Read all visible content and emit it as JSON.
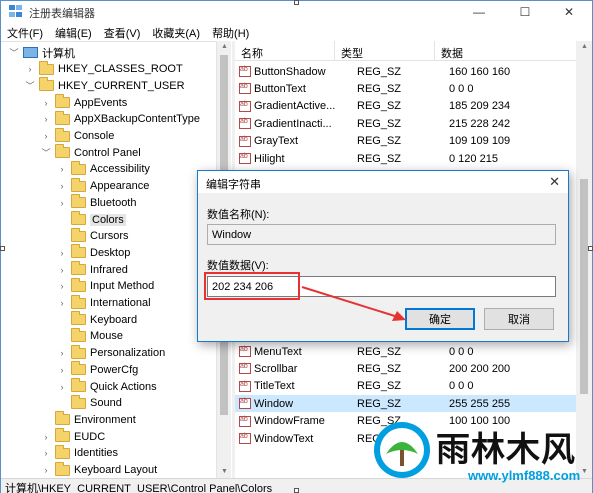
{
  "window": {
    "title": "注册表编辑器",
    "minimize": "—",
    "maximize": "☐",
    "close": "✕"
  },
  "menu": [
    "文件(F)",
    "编辑(E)",
    "查看(V)",
    "收藏夹(A)",
    "帮助(H)"
  ],
  "tree": [
    {
      "label": "计算机",
      "expander": "﹀",
      "icon": "computer"
    },
    {
      "label": "HKEY_CLASSES_ROOT",
      "expander": "›",
      "icon": "folder"
    },
    {
      "label": "HKEY_CURRENT_USER",
      "expander": "﹀",
      "icon": "folder"
    },
    {
      "label": "AppEvents",
      "expander": "›",
      "icon": "folder"
    },
    {
      "label": "AppXBackupContentType",
      "expander": "›",
      "icon": "folder"
    },
    {
      "label": "Console",
      "expander": "›",
      "icon": "folder"
    },
    {
      "label": "Control Panel",
      "expander": "﹀",
      "icon": "folder"
    },
    {
      "label": "Accessibility",
      "expander": "›",
      "icon": "folder"
    },
    {
      "label": "Appearance",
      "expander": "›",
      "icon": "folder"
    },
    {
      "label": "Bluetooth",
      "expander": "›",
      "icon": "folder"
    },
    {
      "label": "Colors",
      "expander": "",
      "icon": "folder",
      "selected": true
    },
    {
      "label": "Cursors",
      "expander": "",
      "icon": "folder"
    },
    {
      "label": "Desktop",
      "expander": "›",
      "icon": "folder"
    },
    {
      "label": "Infrared",
      "expander": "›",
      "icon": "folder"
    },
    {
      "label": "Input Method",
      "expander": "›",
      "icon": "folder"
    },
    {
      "label": "International",
      "expander": "›",
      "icon": "folder"
    },
    {
      "label": "Keyboard",
      "expander": "",
      "icon": "folder"
    },
    {
      "label": "Mouse",
      "expander": "",
      "icon": "folder"
    },
    {
      "label": "Personalization",
      "expander": "›",
      "icon": "folder"
    },
    {
      "label": "PowerCfg",
      "expander": "›",
      "icon": "folder"
    },
    {
      "label": "Quick Actions",
      "expander": "›",
      "icon": "folder"
    },
    {
      "label": "Sound",
      "expander": "",
      "icon": "folder"
    },
    {
      "label": "Environment",
      "expander": "",
      "icon": "folder"
    },
    {
      "label": "EUDC",
      "expander": "›",
      "icon": "folder"
    },
    {
      "label": "Identities",
      "expander": "›",
      "icon": "folder"
    },
    {
      "label": "Keyboard Layout",
      "expander": "›",
      "icon": "folder"
    }
  ],
  "list": {
    "headers": [
      "名称",
      "类型",
      "数据"
    ],
    "rows_top": [
      {
        "name": "ButtonShadow",
        "type": "REG_SZ",
        "data": "160 160 160"
      },
      {
        "name": "ButtonText",
        "type": "REG_SZ",
        "data": "0 0 0"
      },
      {
        "name": "GradientActive...",
        "type": "REG_SZ",
        "data": "185 209 234"
      },
      {
        "name": "GradientInacti...",
        "type": "REG_SZ",
        "data": "215 228 242"
      },
      {
        "name": "GrayText",
        "type": "REG_SZ",
        "data": "109 109 109"
      },
      {
        "name": "Hilight",
        "type": "REG_SZ",
        "data": "0 120 215"
      }
    ],
    "rows_bottom": [
      {
        "name": "MenuText",
        "type": "REG_SZ",
        "data": "0 0 0"
      },
      {
        "name": "Scrollbar",
        "type": "REG_SZ",
        "data": "200 200 200"
      },
      {
        "name": "TitleText",
        "type": "REG_SZ",
        "data": "0 0 0"
      },
      {
        "name": "Window",
        "type": "REG_SZ",
        "data": "255 255 255",
        "selected": true
      },
      {
        "name": "WindowFrame",
        "type": "REG_SZ",
        "data": "100 100 100"
      },
      {
        "name": "WindowText",
        "type": "REG_SZ",
        "data": ""
      }
    ]
  },
  "status": "计算机\\HKEY_CURRENT_USER\\Control Panel\\Colors",
  "dialog": {
    "title": "编辑字符串",
    "close": "✕",
    "name_label": "数值名称(N):",
    "name_value": "Window",
    "data_label": "数值数据(V):",
    "data_value": "202 234 206",
    "ok": "确定",
    "cancel": "取消"
  },
  "watermark": {
    "text": "雨林木风",
    "url": "www.ylmf888.com"
  },
  "colors": {
    "accent": "#0078d7",
    "highlight_box": "#e53333",
    "folder": "#f5d36b",
    "selection": "#cce8ff"
  }
}
